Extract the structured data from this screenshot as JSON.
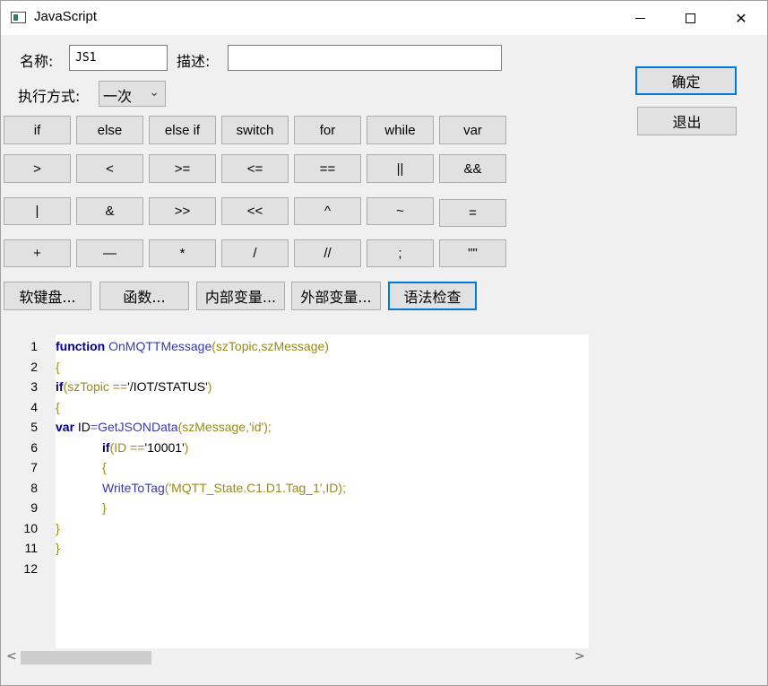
{
  "window": {
    "title": "JavaScript"
  },
  "form": {
    "name_label": "名称:",
    "name_value": "JS1",
    "desc_label": "描述:",
    "desc_value": "",
    "exec_label": "执行方式:",
    "exec_selected": "一次"
  },
  "actions": {
    "ok_label": "确定",
    "exit_label": "退出"
  },
  "keypad": {
    "row1": [
      "if",
      "else",
      "else if",
      "switch",
      "for",
      "while",
      "var"
    ],
    "row2": [
      ">",
      "<",
      ">=",
      "<=",
      "==",
      "||",
      "&&"
    ],
    "row3": [
      "|",
      "&",
      ">>",
      "<<",
      "^",
      "~",
      "="
    ],
    "row4": [
      "+",
      "—",
      "*",
      "/",
      "//",
      ";",
      "\"\""
    ]
  },
  "tools": {
    "soft_keyboard": "软键盘...",
    "functions": "函数...",
    "internal_vars": "内部变量...",
    "external_vars": "外部变量...",
    "syntax_check": "语法检查"
  },
  "code": {
    "line_numbers": [
      "1",
      "2",
      "3",
      "4",
      "5",
      "6",
      "7",
      "8",
      "9",
      "10",
      "11",
      "12"
    ],
    "l1": {
      "kw": "function",
      "fn": "OnMQTTMessage",
      "args": "(szTopic,szMessage)"
    },
    "l2": "{",
    "l3": {
      "kw": "if",
      "rest": "(szTopic ==",
      "str": "'/IOT/STATUS'",
      "close": ")"
    },
    "l4": "{",
    "l5": {
      "kw": "var",
      "id": " ID",
      "eq": "=",
      "fn": "GetJSONData",
      "args": "(szMessage,'id');"
    },
    "l6": {
      "kw": "if",
      "rest": "(ID ==",
      "str": "'10001'",
      "close": ")"
    },
    "l7": "{",
    "l8": {
      "fn": "WriteToTag",
      "args": "('MQTT_State.C1.D1.Tag_1',ID);"
    },
    "l9": "}",
    "l10": "}",
    "l11": "}",
    "l12": ""
  },
  "scrollbar": {
    "left_arrow": "<",
    "right_arrow": ">"
  },
  "colors": {
    "keyword": "#00008b",
    "function": "#3a3aa8",
    "brace": "#9a8a1a",
    "focus": "#0078d7"
  }
}
